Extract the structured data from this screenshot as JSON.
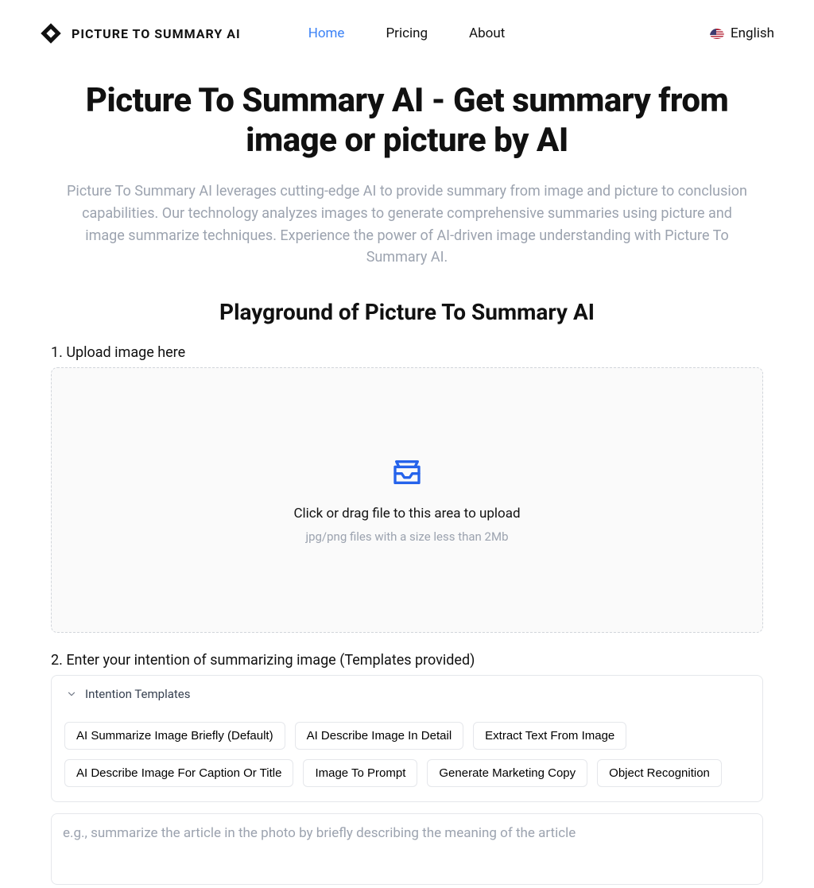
{
  "brand": "PICTURE TO SUMMARY AI",
  "nav": {
    "home": "Home",
    "pricing": "Pricing",
    "about": "About"
  },
  "language": "English",
  "hero": {
    "title": "Picture To Summary AI - Get summary from image or picture by AI",
    "subhead": "Picture To Summary AI leverages cutting-edge AI to provide summary from image and picture to conclusion capabilities. Our technology analyzes images to generate comprehensive summaries using picture and image summarize techniques. Experience the power of AI-driven image understanding with Picture To Summary AI."
  },
  "playground": {
    "heading": "Playground of Picture To Summary AI",
    "step1_label": "1. Upload image here",
    "drop_title": "Click or drag file to this area to upload",
    "drop_hint": "jpg/png files with a size less than 2Mb",
    "step2_label": "2. Enter your intention of summarizing image (Templates provided)",
    "templates_header": "Intention Templates",
    "templates": [
      "AI Summarize Image Briefly (Default)",
      "AI Describe Image In Detail",
      "Extract Text From Image",
      "AI Describe Image For Caption Or Title",
      "Image To Prompt",
      "Generate Marketing Copy",
      "Object Recognition"
    ],
    "intent_placeholder": "e.g., summarize the article in the photo by briefly describing the meaning of the article"
  }
}
